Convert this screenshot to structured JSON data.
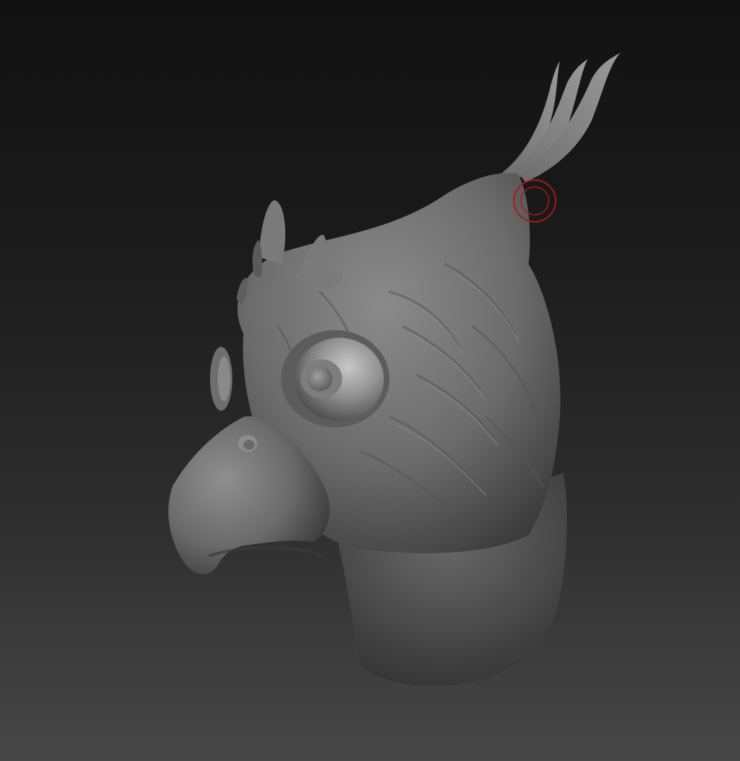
{
  "app": {
    "name": "",
    "view": "3d-sculpt-viewport"
  },
  "viewport": {
    "background_top": "#121212",
    "background_bottom": "#474747",
    "model": {
      "subject": "griffin-bird-head-bust",
      "material_color": "#6f6f6f",
      "highlight_color": "#a8a8a8",
      "shadow_color": "#2e2e2e"
    },
    "brush_cursor": {
      "ring_color": "#b01818",
      "icon": "brush-cursor-icon"
    }
  }
}
